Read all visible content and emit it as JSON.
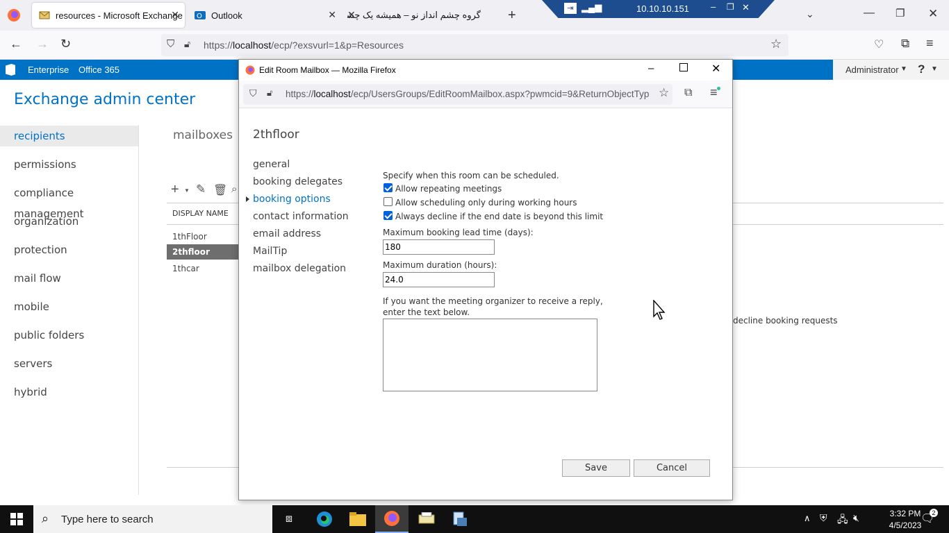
{
  "browser": {
    "tabs": [
      {
        "title": "resources - Microsoft Exchange"
      },
      {
        "title": "Outlook"
      },
      {
        "title": "گروه چشم انداز نو – همیشه یک چشم"
      }
    ],
    "url_prefix": "https://",
    "url_host": "localhost",
    "url_path": "/ecp/?exsvurl=1&p=Resources"
  },
  "rdp": {
    "host": "10.10.10.151"
  },
  "o365": {
    "enterprise": "Enterprise",
    "office365": "Office 365",
    "admin": "Administrator",
    "help": "?"
  },
  "eac": {
    "title": "Exchange admin center",
    "nav": [
      "recipients",
      "permissions",
      "compliance management",
      "organization",
      "protection",
      "mail flow",
      "mobile",
      "public folders",
      "servers",
      "hybrid"
    ],
    "tab_mailboxes": "mailboxes",
    "col_display_name": "DISPLAY NAME",
    "rows": [
      "1thFloor",
      "2thfloor",
      "1thcar"
    ],
    "detail_text": "decline booking requests"
  },
  "popup": {
    "window_title": "Edit Room Mailbox — Mozilla Firefox",
    "url_prefix": "https://",
    "url_host": "localhost",
    "url_path": "/ecp/UsersGroups/EditRoomMailbox.aspx?pwmcid=9&ReturnObjectTyp",
    "heading": "2thfloor",
    "sections": [
      "general",
      "booking delegates",
      "booking options",
      "contact information",
      "email address",
      "MailTip",
      "mailbox delegation"
    ],
    "schedule_label": "Specify when this room can be scheduled.",
    "options": [
      {
        "label": "Allow repeating meetings",
        "checked": true
      },
      {
        "label": "Allow scheduling only during working hours",
        "checked": false
      },
      {
        "label": "Always decline if the end date is beyond this limit",
        "checked": true
      }
    ],
    "lead_time_label": "Maximum booking lead time (days):",
    "lead_time_value": "180",
    "duration_label": "Maximum duration (hours):",
    "duration_value": "24.0",
    "reply_label_1": "If you want the meeting organizer to receive a reply,",
    "reply_label_2": "enter the text below.",
    "reply_text": "",
    "save": "Save",
    "cancel": "Cancel"
  },
  "taskbar": {
    "search_placeholder": "Type here to search",
    "time": "3:32 PM",
    "date": "4/5/2023"
  },
  "colors": {
    "accent": "#0072c6",
    "taskbar": "#101010",
    "firefox_blue": "#0060df"
  }
}
